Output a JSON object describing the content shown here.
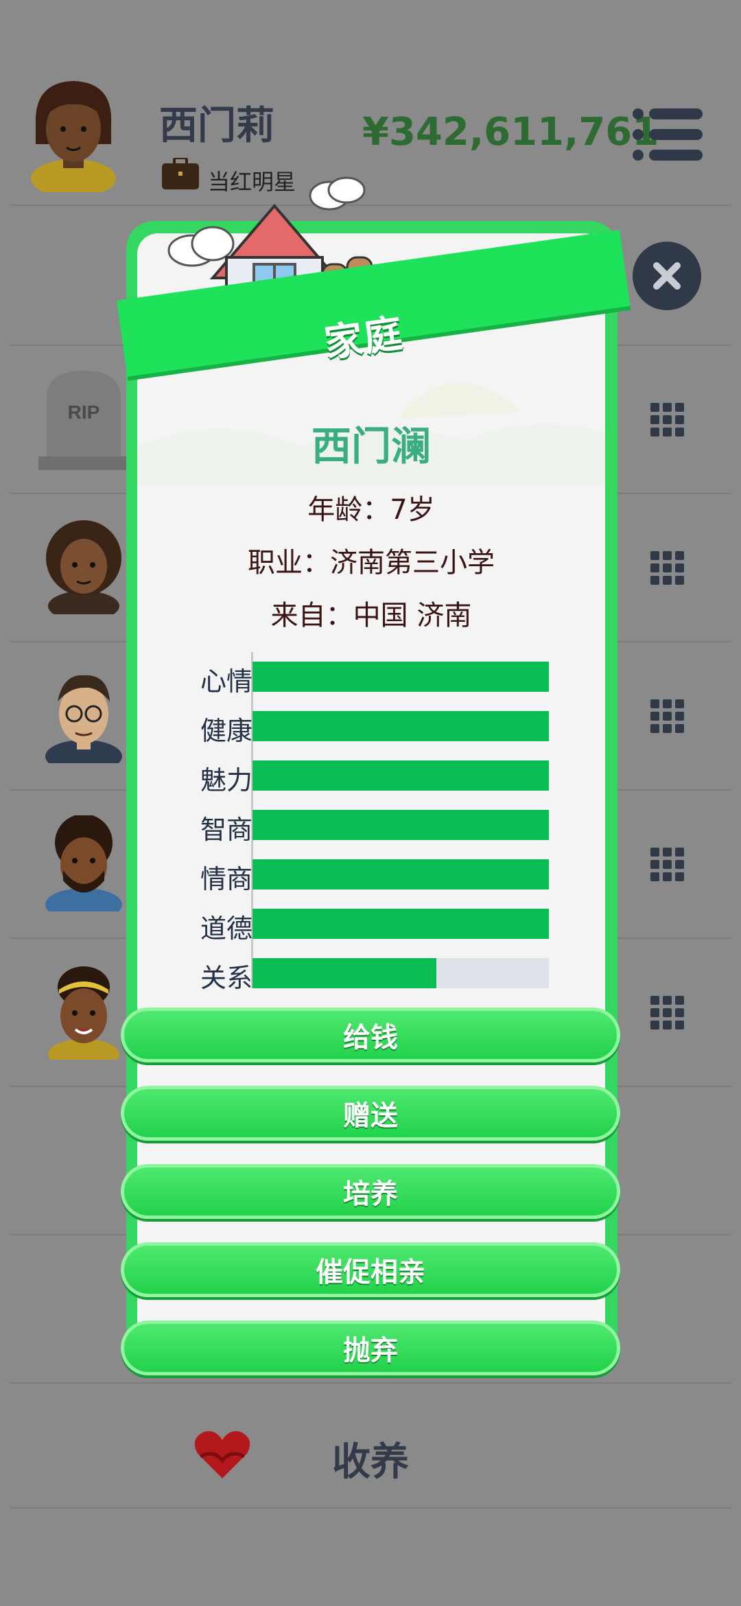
{
  "header": {
    "player_name": "西门莉",
    "job": "当红明星",
    "money": "¥342,611,761"
  },
  "modal": {
    "banner_title": "家庭",
    "child_name": "西门澜",
    "age": "年龄：7岁",
    "occupation": "职业：济南第三小学",
    "origin": "来自：中国 济南",
    "stats": [
      {
        "label": "心情",
        "value": 1.0
      },
      {
        "label": "健康",
        "value": 1.0
      },
      {
        "label": "魅力",
        "value": 1.0
      },
      {
        "label": "智商",
        "value": 1.0
      },
      {
        "label": "情商",
        "value": 1.0
      },
      {
        "label": "道德",
        "value": 1.0
      },
      {
        "label": "关系",
        "value": 0.62
      }
    ],
    "buttons": {
      "give_money": "给钱",
      "gift": "赠送",
      "cultivate": "培养",
      "urge_dating": "催促相亲",
      "abandon": "抛弃"
    }
  },
  "footer": {
    "adopt_label": "收养"
  },
  "colors": {
    "accent_green": "#1ee35a",
    "bar_fill": "#0bbc55",
    "money": "#2e6b33",
    "overlay": "#8a8a8a"
  },
  "icons": [
    "briefcase-icon",
    "menu-icon",
    "close-icon",
    "grid-icon",
    "heart-hands-icon",
    "house-icon",
    "tombstone-icon"
  ]
}
